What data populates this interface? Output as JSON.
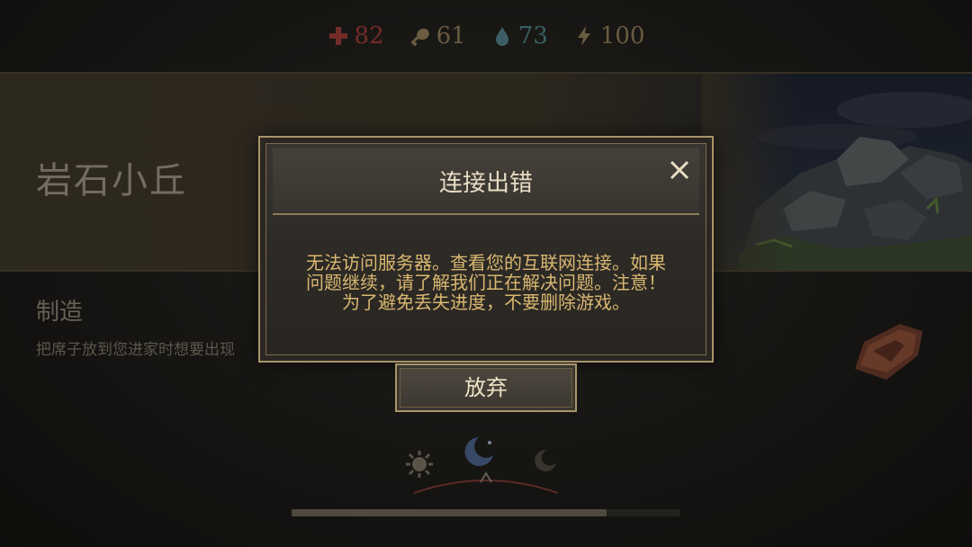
{
  "stats": {
    "health": "82",
    "food": "61",
    "water": "73",
    "energy": "100"
  },
  "location": {
    "title": "岩石小丘"
  },
  "craft": {
    "title": "制造",
    "description": "把席子放到您进家时想要出现"
  },
  "dialog": {
    "title": "连接出错",
    "message_line1": "无法访问服务器。查看您的互联网连接。如果",
    "message_line2": "问题继续，请了解我们正在解决问题。注意！",
    "message_line3": "为了避免丢失进度，不要删除游戏。",
    "abandon_label": "放弃"
  },
  "progress": {
    "fraction": 0.81
  },
  "colors": {
    "health": "#9b3b36",
    "water": "#4f7f86",
    "gold_text": "#d9b770",
    "border_gold": "#a8946b"
  },
  "icons": [
    "health-cross-icon",
    "food-drumstick-icon",
    "water-drop-icon",
    "energy-bolt-icon",
    "close-icon",
    "sun-icon",
    "moon-icon"
  ]
}
